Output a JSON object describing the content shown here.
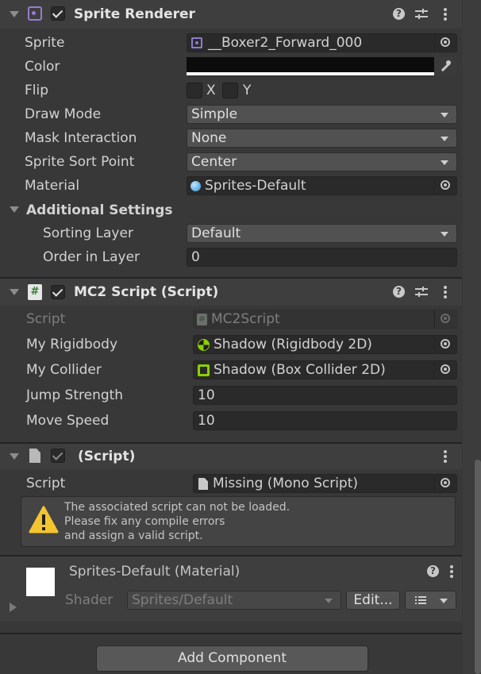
{
  "sprite_renderer": {
    "title": "Sprite Renderer",
    "enabled": true,
    "fields": {
      "sprite_label": "Sprite",
      "sprite_value": "__Boxer2_Forward_000",
      "color_label": "Color",
      "color_value": "#0c0c0c",
      "flip_label": "Flip",
      "flip_x": "X",
      "flip_y": "Y",
      "draw_mode_label": "Draw Mode",
      "draw_mode_value": "Simple",
      "mask_label": "Mask Interaction",
      "mask_value": "None",
      "sort_point_label": "Sprite Sort Point",
      "sort_point_value": "Center",
      "material_label": "Material",
      "material_value": "Sprites-Default"
    },
    "additional": {
      "title": "Additional Settings",
      "sorting_layer_label": "Sorting Layer",
      "sorting_layer_value": "Default",
      "order_label": "Order in Layer",
      "order_value": "0"
    }
  },
  "mc2_script": {
    "title": "MC2 Script (Script)",
    "enabled": true,
    "script_label": "Script",
    "script_value": "MC2Script",
    "rigidbody_label": "My Rigidbody",
    "rigidbody_value": "Shadow (Rigidbody 2D)",
    "collider_label": "My Collider",
    "collider_value": "Shadow (Box Collider 2D)",
    "jump_label": "Jump Strength",
    "jump_value": "10",
    "speed_label": "Move Speed",
    "speed_value": "10"
  },
  "missing_script": {
    "title": "(Script)",
    "script_label": "Script",
    "script_value": "Missing (Mono Script)",
    "warning_lines": [
      "The associated script can not be loaded.",
      "Please fix any compile errors",
      "and assign a valid script."
    ]
  },
  "material": {
    "title": "Sprites-Default (Material)",
    "shader_label": "Shader",
    "shader_value": "Sprites/Default",
    "edit_label": "Edit..."
  },
  "add_component_label": "Add Component",
  "colors": {
    "background": "#383838",
    "header": "#3e3e3e",
    "field": "#2a2a2a",
    "dropdown": "#515151",
    "warning": "#f4c430"
  },
  "icons": [
    "sprite-renderer-icon",
    "help-icon",
    "presets-icon",
    "kebab-menu-icon",
    "object-picker-icon",
    "eyedropper-icon",
    "csharp-script-icon",
    "rigidbody-icon",
    "box-collider-icon",
    "file-icon",
    "warning-icon",
    "material-icon",
    "list-icon",
    "chevron-down-icon"
  ]
}
